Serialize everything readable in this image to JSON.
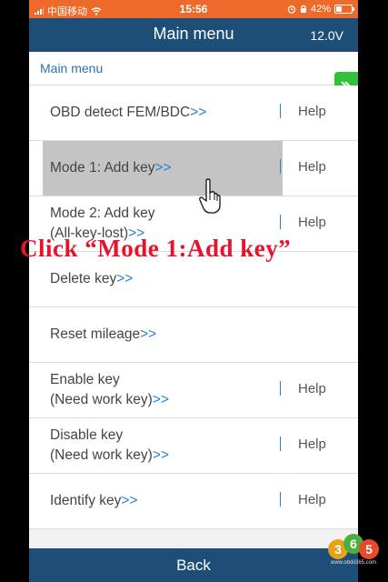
{
  "status_bar": {
    "carrier": "中国移动",
    "time": "15:56",
    "battery": "42%",
    "battery_level": 0.42
  },
  "header": {
    "title": "Main menu",
    "voltage": "12.0V"
  },
  "breadcrumb": "Main menu",
  "menu": {
    "items": [
      {
        "line1": "OBD detect FEM/BDC",
        "line2": "",
        "arrows": ">>",
        "help": "Help"
      },
      {
        "line1": "Mode 1: Add key",
        "line2": "",
        "arrows": ">>",
        "help": "Help"
      },
      {
        "line1": "Mode 2: Add key",
        "line2": "(All-key-lost)",
        "arrows": ">>",
        "help": "Help"
      },
      {
        "line1": "Delete key",
        "line2": "",
        "arrows": ">>",
        "help": ""
      },
      {
        "line1": "Reset mileage",
        "line2": "",
        "arrows": ">>",
        "help": ""
      },
      {
        "line1": "Enable key",
        "line2": "(Need work key)",
        "arrows": ">>",
        "help": "Help"
      },
      {
        "line1": "Disable key",
        "line2": "(Need work key)",
        "arrows": ">>",
        "help": "Help"
      },
      {
        "line1": "Identify key",
        "line2": "",
        "arrows": ">>",
        "help": "Help"
      }
    ]
  },
  "annotation": "Click “Mode 1:Add key”",
  "footer": {
    "back_label": "Back"
  },
  "watermark": {
    "logo_text": "365",
    "site": "www.obdii365.com"
  },
  "colors": {
    "status_bar": "#ee6a2a",
    "header": "#1d4e78",
    "accent_blue": "#2a7fd0",
    "annotation_red": "#e8132b",
    "expand_tab": "#2fc23a"
  }
}
